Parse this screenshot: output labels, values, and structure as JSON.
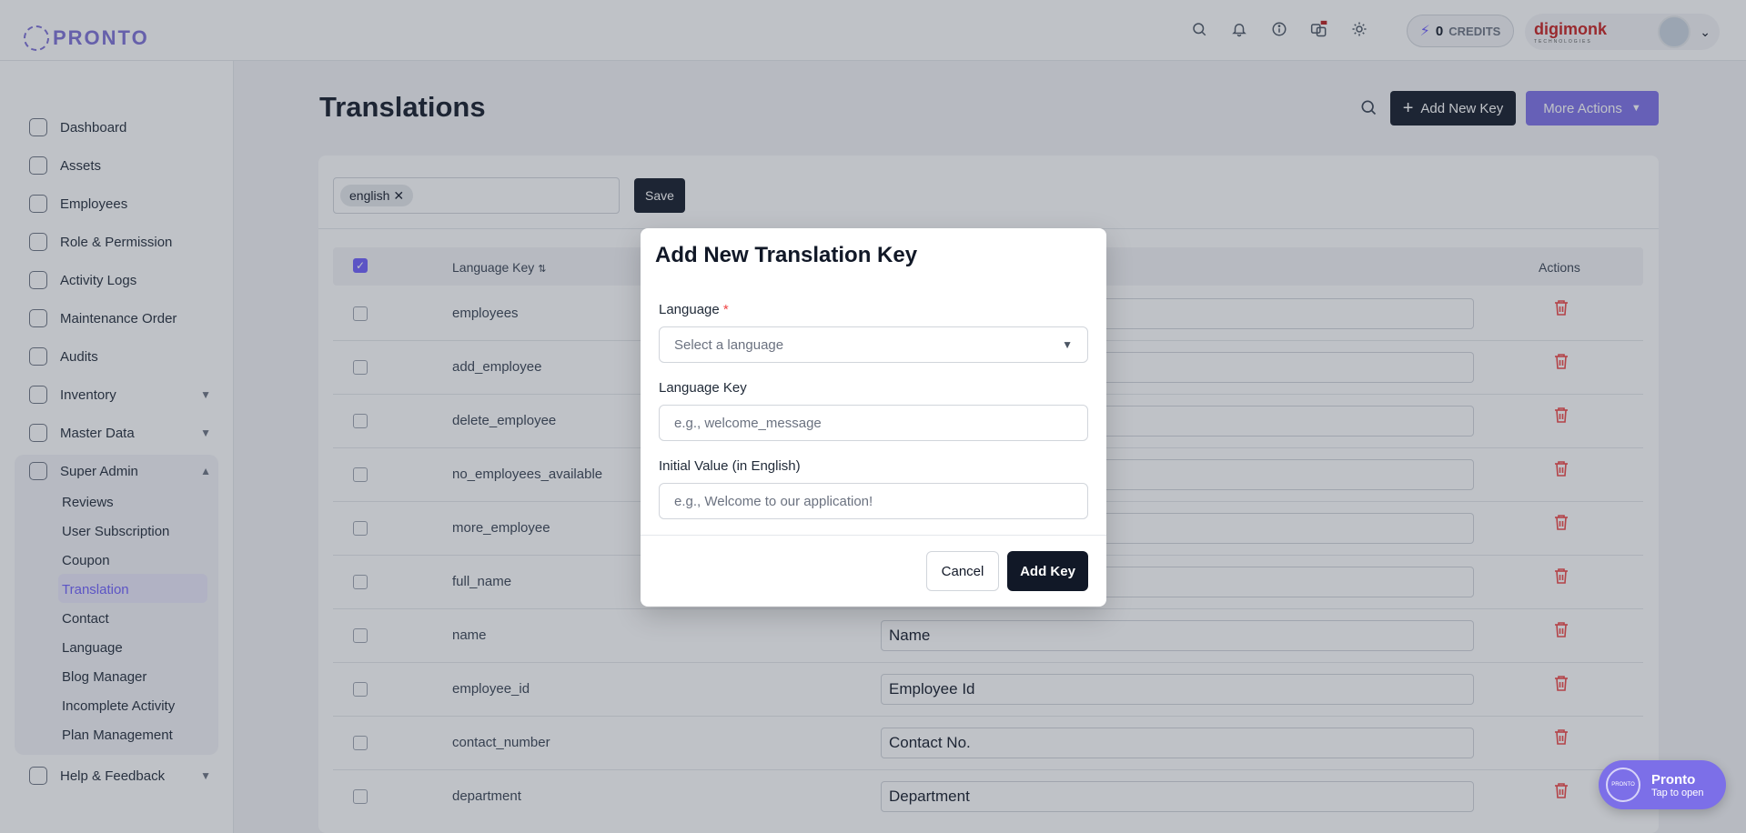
{
  "brand": {
    "logo_text": "PRONTO",
    "company": "digimonk",
    "company_sub": "TECHNOLOGIES"
  },
  "header": {
    "credits_count": "0",
    "credits_label": "CREDITS"
  },
  "sidebar": {
    "items": [
      {
        "label": "Dashboard"
      },
      {
        "label": "Assets"
      },
      {
        "label": "Employees"
      },
      {
        "label": "Role & Permission"
      },
      {
        "label": "Activity Logs"
      },
      {
        "label": "Maintenance Order"
      },
      {
        "label": "Audits"
      },
      {
        "label": "Inventory"
      },
      {
        "label": "Master Data"
      },
      {
        "label": "Super Admin"
      },
      {
        "label": "Help & Feedback"
      }
    ],
    "super_admin_sub": [
      {
        "label": "Reviews"
      },
      {
        "label": "User Subscription"
      },
      {
        "label": "Coupon"
      },
      {
        "label": "Translation"
      },
      {
        "label": "Contact"
      },
      {
        "label": "Language"
      },
      {
        "label": "Blog Manager"
      },
      {
        "label": "Incomplete Activity"
      },
      {
        "label": "Plan Management"
      }
    ]
  },
  "page": {
    "title": "Translations",
    "add_new_key": "Add New Key",
    "more_actions": "More Actions",
    "chip": "english",
    "save": "Save"
  },
  "table": {
    "col_key": "Language Key",
    "col_actions": "Actions",
    "rows": [
      {
        "key": "employees",
        "value": ""
      },
      {
        "key": "add_employee",
        "value": ""
      },
      {
        "key": "delete_employee",
        "value": ""
      },
      {
        "key": "no_employees_available",
        "value": ""
      },
      {
        "key": "more_employee",
        "value": ""
      },
      {
        "key": "full_name",
        "value": ""
      },
      {
        "key": "name",
        "value": "Name"
      },
      {
        "key": "employee_id",
        "value": "Employee Id"
      },
      {
        "key": "contact_number",
        "value": "Contact No."
      },
      {
        "key": "department",
        "value": "Department"
      }
    ]
  },
  "modal": {
    "title": "Add New Translation Key",
    "language_label": "Language",
    "required_mark": "*",
    "language_placeholder": "Select a language",
    "key_label": "Language Key",
    "key_placeholder": "e.g., welcome_message",
    "value_label": "Initial Value (in English)",
    "value_placeholder": "e.g., Welcome to our application!",
    "cancel": "Cancel",
    "add": "Add Key"
  },
  "widget": {
    "title": "Pronto",
    "subtitle": "Tap to open",
    "logo_text": "PRONTO"
  },
  "colors": {
    "accent": "#7c6fe8",
    "dark": "#111827",
    "danger": "#ef4444"
  }
}
